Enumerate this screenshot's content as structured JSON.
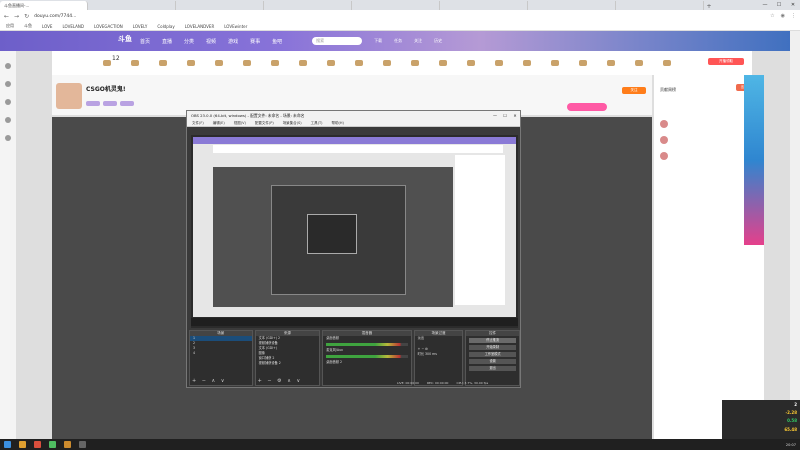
{
  "browser": {
    "tabs": [
      {
        "label": "斗鱼直播间-...",
        "active": true
      },
      {
        "label": "",
        "active": false
      },
      {
        "label": "",
        "active": false
      },
      {
        "label": "",
        "active": false
      },
      {
        "label": "",
        "active": false
      },
      {
        "label": "",
        "active": false
      },
      {
        "label": "",
        "active": false
      },
      {
        "label": "",
        "active": false
      }
    ],
    "url": "douyu.com/7744...",
    "bookmarks": [
      "应用",
      "斗鱼",
      "",
      "",
      "",
      "",
      "LOVE",
      "LOVELAND",
      "LOVEGACTION",
      "LOVELY",
      "Coldplay",
      "LOVELANDVER",
      "LOVEwinter"
    ]
  },
  "site": {
    "logo": "斗鱼",
    "nav": [
      "首页",
      "直播",
      "分类",
      "视频",
      "游戏",
      "赛事",
      "鱼吧"
    ],
    "search_placeholder": "搜索",
    "header_icons": [
      "下载",
      "任务",
      "关注",
      "历史"
    ],
    "promo_label": "开播领取"
  },
  "room": {
    "rank": "12",
    "title": "CSGO机灵鬼!",
    "follow_label": "关注"
  },
  "right_panel": {
    "title": "贡献周榜",
    "button_label": "查看更多",
    "rank_names": [
      "",
      "",
      ""
    ],
    "chat_text": ""
  },
  "obs": {
    "title": "OBS 23.0.0 (64-bit, windows) - 配置文件: 未命名 - 场景: 未命名",
    "menu": [
      "文件(F)",
      "编辑(E)",
      "视图(V)",
      "配置文件(P)",
      "场景集合(S)",
      "工具(T)",
      "帮助(H)"
    ],
    "docks": {
      "scenes": {
        "title": "场景",
        "items": [
          "1",
          "2",
          "3",
          "4"
        ]
      },
      "sources": {
        "title": "来源",
        "items": [
          "文本 (GDI+) 2",
          "视频捕获设备",
          "文本 (GDI+)",
          "图像",
          "窗口捕获 2",
          "视频捕获设备 2"
        ]
      },
      "mixer": {
        "title": "混音器",
        "tracks": [
          "桌面音频",
          "麦克风/Aux",
          "桌面音频 2"
        ]
      },
      "transitions": {
        "title": "场景过渡",
        "fade": "淡出",
        "duration_label": "时长",
        "duration": "300 ms"
      },
      "controls": {
        "title": "控件",
        "buttons": [
          "停止推流",
          "开始录制",
          "工作室模式",
          "设置",
          "退出"
        ]
      }
    },
    "status": [
      "LIVE: 00:00:00",
      "REC: 00:00:00",
      "CPU: 3.7%, 30.00 fps"
    ]
  },
  "overlay": {
    "values": [
      {
        "text": "2",
        "color": "#ffffff"
      },
      {
        "text": "-2.28",
        "color": "#ffcc33"
      },
      {
        "text": "0.58",
        "color": "#33cc66"
      },
      {
        "text": "65.48",
        "color": "#ffcc33"
      }
    ]
  }
}
